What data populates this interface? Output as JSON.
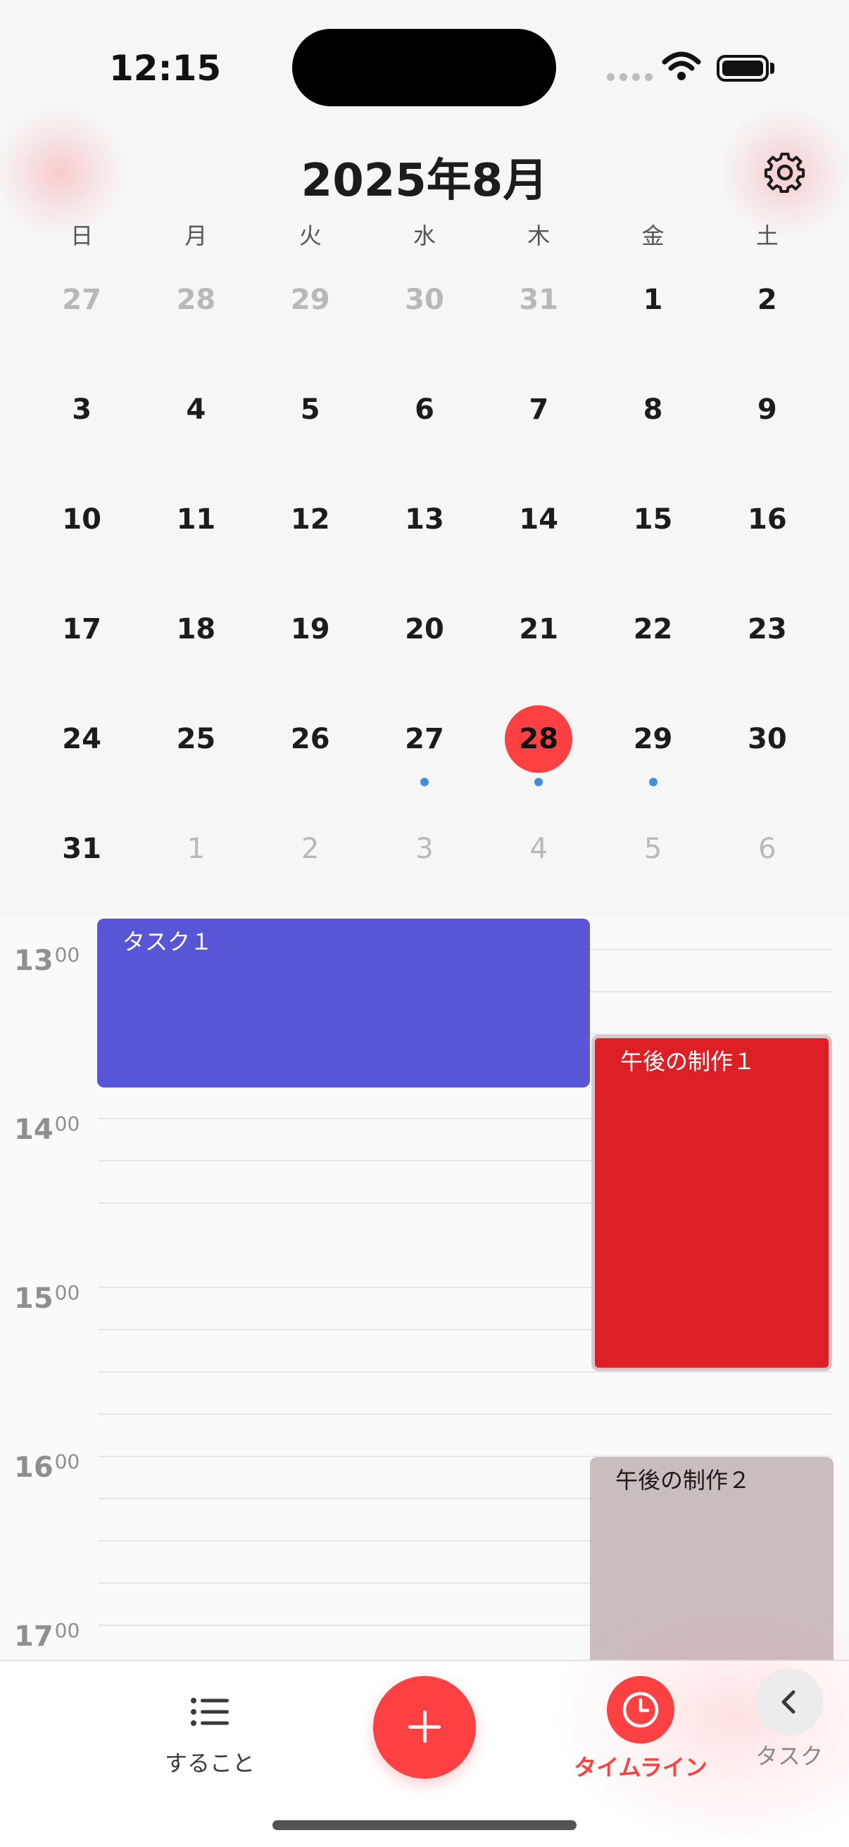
{
  "status_bar": {
    "time": "12:15"
  },
  "header": {
    "month_title": "2025年8月"
  },
  "calendar": {
    "weekdays": [
      "日",
      "月",
      "火",
      "水",
      "木",
      "金",
      "土"
    ],
    "weeks": [
      [
        "27",
        "28",
        "29",
        "30",
        "31",
        "1",
        "2"
      ],
      [
        "3",
        "4",
        "5",
        "6",
        "7",
        "8",
        "9"
      ],
      [
        "10",
        "11",
        "12",
        "13",
        "14",
        "15",
        "16"
      ],
      [
        "17",
        "18",
        "19",
        "20",
        "21",
        "22",
        "23"
      ],
      [
        "24",
        "25",
        "26",
        "27",
        "28",
        "29",
        "30"
      ],
      [
        "31",
        "1",
        "2",
        "3",
        "4",
        "5",
        "6"
      ]
    ],
    "today": "28",
    "event_dot_days": [
      "27",
      "28",
      "29"
    ]
  },
  "timeline": {
    "hours": [
      {
        "h": "13",
        "m": "00"
      },
      {
        "h": "14",
        "m": "00"
      },
      {
        "h": "15",
        "m": "00"
      },
      {
        "h": "16",
        "m": "00"
      },
      {
        "h": "17",
        "m": "00"
      }
    ],
    "events": [
      {
        "title": "タスク１",
        "color": "#5856d6"
      },
      {
        "title": "午後の制作１",
        "color": "#dd2025"
      },
      {
        "title": "午後の制作２",
        "color": "#c9bdbe"
      }
    ]
  },
  "tabbar": {
    "todo_label": "すること",
    "timeline_label": "タイムライン",
    "back_label": "タスク"
  },
  "colors": {
    "accent": "#fd4041",
    "dot": "#3f8fde"
  }
}
